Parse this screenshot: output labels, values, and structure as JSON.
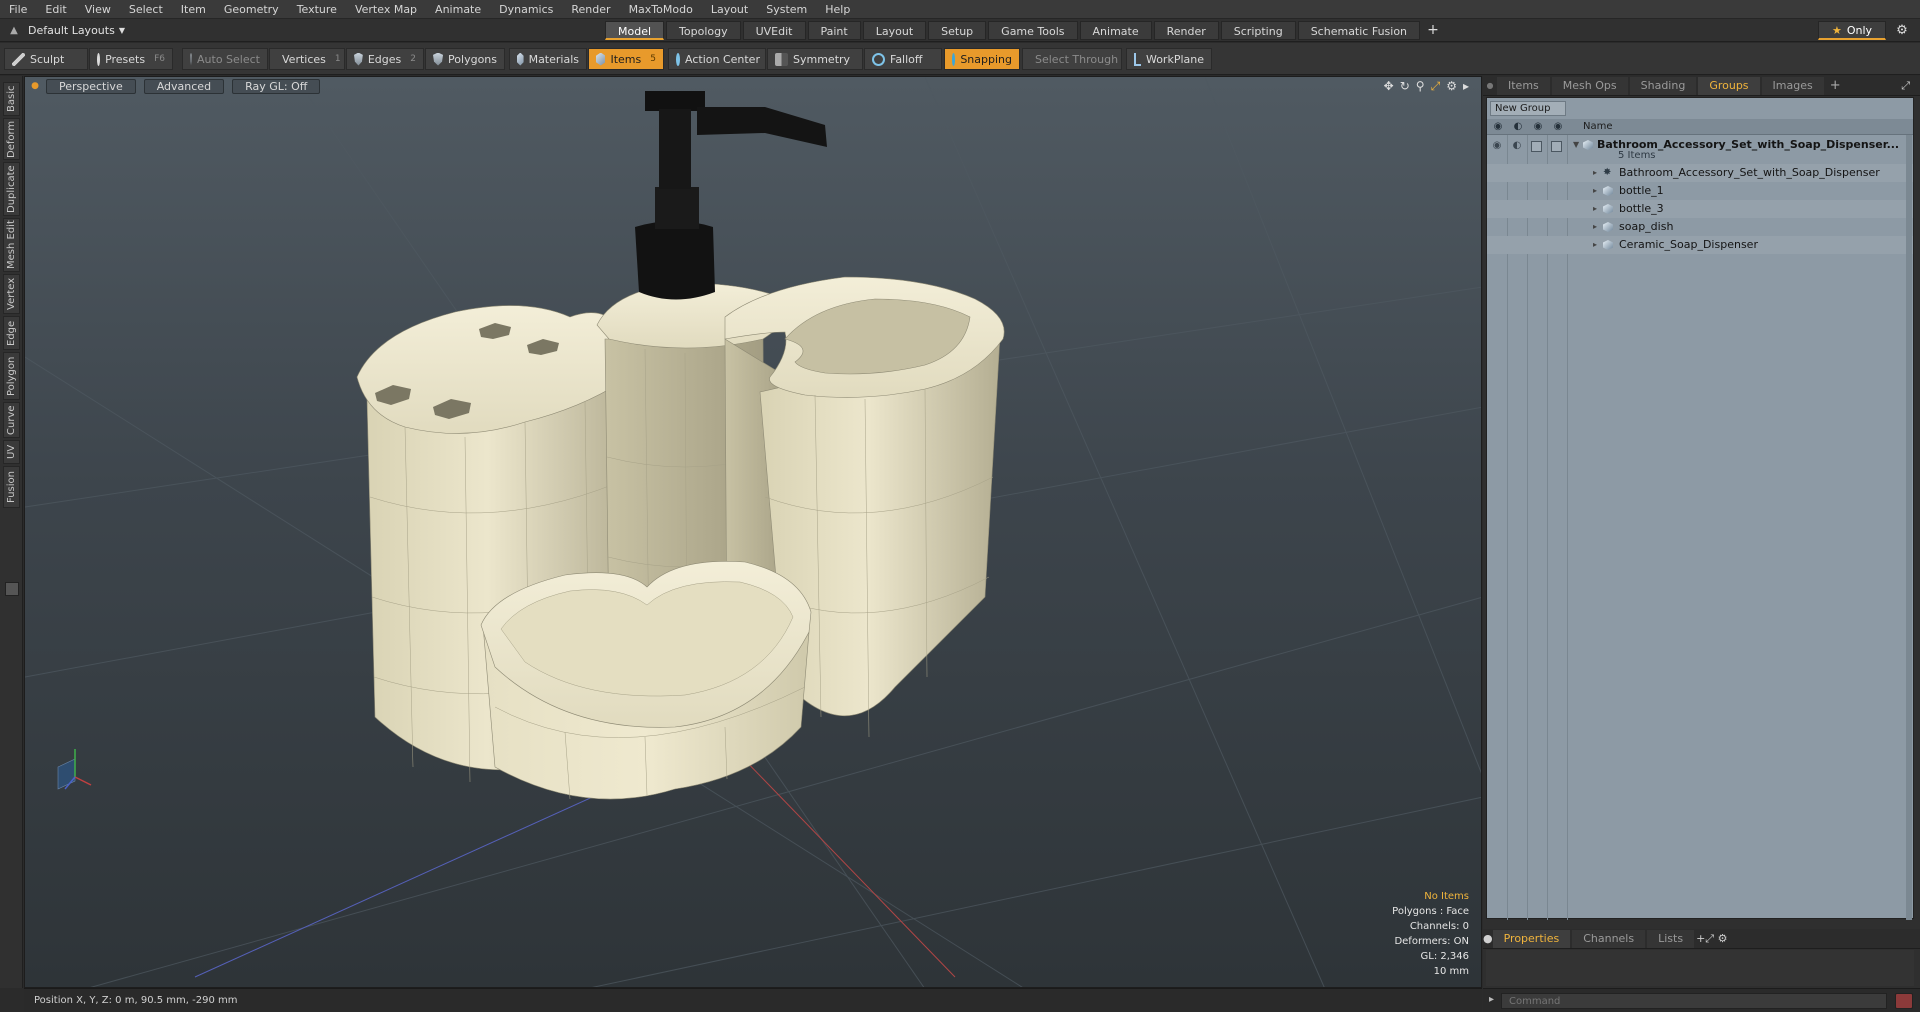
{
  "menu": [
    "File",
    "Edit",
    "View",
    "Select",
    "Item",
    "Geometry",
    "Texture",
    "Vertex Map",
    "Animate",
    "Dynamics",
    "Render",
    "MaxToModo",
    "Layout",
    "System",
    "Help"
  ],
  "layout_selector": "Default Layouts",
  "top_tabs": [
    "Model",
    "Topology",
    "UVEdit",
    "Paint",
    "Layout",
    "Setup",
    "Game Tools",
    "Animate",
    "Render",
    "Scripting",
    "Schematic Fusion"
  ],
  "only_label": "Only",
  "toolbar": {
    "sculpt": "Sculpt",
    "presets": "Presets",
    "presets_key": "F6",
    "auto_select": "Auto Select",
    "vertices": "Vertices",
    "vertices_key": "1",
    "edges": "Edges",
    "edges_key": "2",
    "polygons": "Polygons",
    "materials": "Materials",
    "items": "Items",
    "items_key": "5",
    "action_center": "Action Center",
    "symmetry": "Symmetry",
    "falloff": "Falloff",
    "snapping": "Snapping",
    "select_through": "Select Through",
    "workplane": "WorkPlane"
  },
  "left_tabs": [
    "Basic",
    "Deform",
    "Duplicate",
    "Mesh Edit",
    "Vertex",
    "Edge",
    "Polygon",
    "Curve",
    "UV",
    "Fusion"
  ],
  "viewport": {
    "view": "Perspective",
    "mode": "Advanced",
    "raygl": "Ray GL: Off",
    "info": {
      "selection": "No Items",
      "polygons": "Polygons : Face",
      "channels": "Channels: 0",
      "deformers": "Deformers: ON",
      "gl": "GL: 2,346",
      "scale": "10 mm"
    }
  },
  "status_text": "Position X, Y, Z:   0 m, 90.5 mm, -290 mm",
  "right_panel": {
    "tabs": [
      "Items",
      "Mesh Ops",
      "Shading",
      "Groups",
      "Images"
    ],
    "active_tab": "Groups",
    "new_group": "New Group",
    "col_name": "Name",
    "group_name": "Bathroom_Accessory_Set_with_Soap_Dispenser...",
    "group_count": "5 Items",
    "items": [
      "Bathroom_Accessory_Set_with_Soap_Dispenser",
      "bottle_1",
      "bottle_3",
      "soap_dish",
      "Ceramic_Soap_Dispenser"
    ],
    "bottom_tabs": [
      "Properties",
      "Channels",
      "Lists"
    ],
    "command_placeholder": "Command"
  },
  "colors": {
    "accent": "#e89a2b",
    "ceramic": "#ece6cc",
    "pump": "#161616",
    "panel_blue": "#8d9aa5"
  }
}
